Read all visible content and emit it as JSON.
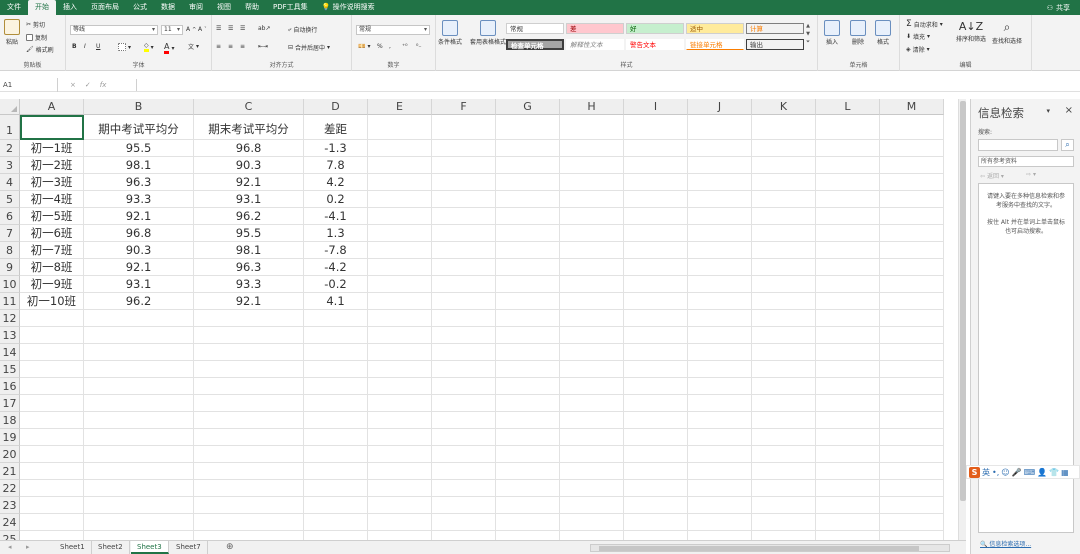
{
  "tabs": [
    "文件",
    "开始",
    "插入",
    "页面布局",
    "公式",
    "数据",
    "审阅",
    "视图",
    "帮助",
    "PDF工具集"
  ],
  "tell_me": "操作说明搜索",
  "share": "共享",
  "ribbon": {
    "clipboard": {
      "paste": "粘贴",
      "cut": "剪切",
      "copy": "复制",
      "format_painter": "格式刷",
      "label": "剪贴板"
    },
    "font": {
      "name": "等线",
      "size": "11",
      "bold": "B",
      "italic": "I",
      "underline": "U",
      "label": "字体"
    },
    "align": {
      "wrap": "自动换行",
      "merge": "合并后居中",
      "label": "对齐方式"
    },
    "number": {
      "format": "常规",
      "percent": "%",
      "comma": ",",
      "label": "数字"
    },
    "styles": {
      "cond": "条件格式",
      "table": "套用表格格式",
      "items": [
        "常规",
        "差",
        "好",
        "适中",
        "计算",
        "检查单元格",
        "解释性文本",
        "警告文本",
        "链接单元格",
        "输出"
      ],
      "label": "样式"
    },
    "cells": {
      "insert": "插入",
      "delete": "删除",
      "format": "格式",
      "label": "单元格"
    },
    "edit": {
      "autosum": "自动求和",
      "fill": "填充",
      "clear": "清除",
      "sort": "排序和筛选",
      "find": "查找和选择",
      "label": "编辑"
    }
  },
  "formula": {
    "namebox": "A1",
    "fx": "fx",
    "cancel": "×",
    "enter": "✓",
    "value": ""
  },
  "columns": [
    "A",
    "B",
    "C",
    "D",
    "E",
    "F",
    "G",
    "H",
    "I",
    "J",
    "K",
    "L",
    "M"
  ],
  "rows": [
    "1",
    "2",
    "3",
    "4",
    "5",
    "6",
    "7",
    "8",
    "9",
    "10",
    "11",
    "12",
    "13",
    "14",
    "15",
    "16",
    "17",
    "18",
    "19",
    "20",
    "21",
    "22",
    "23",
    "24",
    "25"
  ],
  "table": {
    "header": [
      "",
      "期中考试平均分",
      "期末考试平均分",
      "差距"
    ],
    "rows": [
      [
        "初一1班",
        "95.5",
        "96.8",
        "-1.3"
      ],
      [
        "初一2班",
        "98.1",
        "90.3",
        "7.8"
      ],
      [
        "初一3班",
        "96.3",
        "92.1",
        "4.2"
      ],
      [
        "初一4班",
        "93.3",
        "93.1",
        "0.2"
      ],
      [
        "初一5班",
        "92.1",
        "96.2",
        "-4.1"
      ],
      [
        "初一6班",
        "96.8",
        "95.5",
        "1.3"
      ],
      [
        "初一7班",
        "90.3",
        "98.1",
        "-7.8"
      ],
      [
        "初一8班",
        "92.1",
        "96.3",
        "-4.2"
      ],
      [
        "初一9班",
        "93.1",
        "93.3",
        "-0.2"
      ],
      [
        "初一10班",
        "96.2",
        "92.1",
        "4.1"
      ]
    ]
  },
  "sheets": [
    "Sheet1",
    "Sheet2",
    "Sheet3",
    "Sheet7"
  ],
  "active_sheet": "Sheet3",
  "pane": {
    "title": "信息检索",
    "search_label": "搜索:",
    "source": "所有参考资料",
    "back": "返回",
    "hint1": "请键入要在多种信息检索和参考服务中查找的文字。",
    "hint2": "按住 Alt 并在单词上单击鼠标也可启动搜索。",
    "options": "信息检索选项..."
  },
  "ime": {
    "logo": "S",
    "lang": "英"
  },
  "colors": {
    "accent": "#217346",
    "bad": "#ffc7ce",
    "good": "#c6efce",
    "neutral": "#ffeb9c"
  }
}
